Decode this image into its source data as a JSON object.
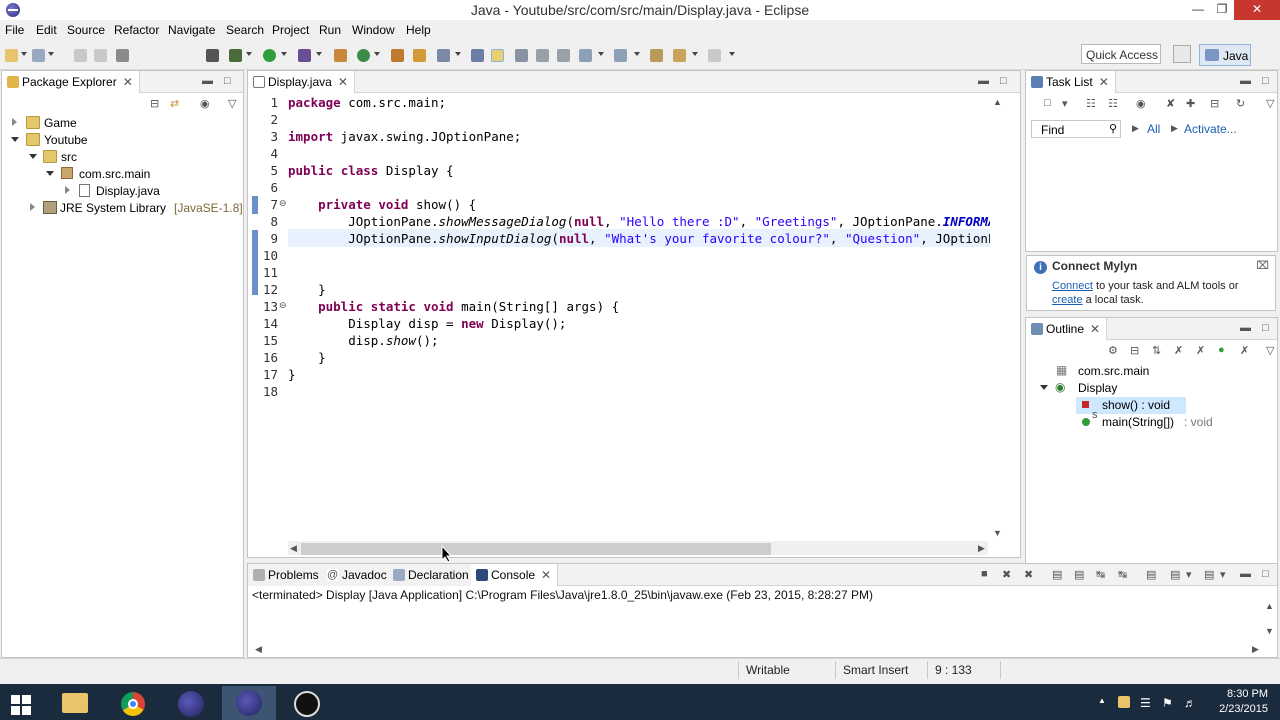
{
  "window": {
    "title": "Java - Youtube/src/com/src/main/Display.java - Eclipse"
  },
  "menu": [
    "File",
    "Edit",
    "Source",
    "Refactor",
    "Navigate",
    "Search",
    "Project",
    "Run",
    "Window",
    "Help"
  ],
  "toolbar": {
    "quick_access": "Quick Access",
    "perspective": "Java"
  },
  "package_explorer": {
    "title": "Package Explorer",
    "items": [
      {
        "label": "Game"
      },
      {
        "label": "Youtube"
      },
      {
        "label": "src"
      },
      {
        "label": "com.src.main"
      },
      {
        "label": "Display.java"
      },
      {
        "label": "JRE System Library",
        "suffix": "[JavaSE-1.8]"
      }
    ]
  },
  "editor": {
    "tab": "Display.java",
    "line_numbers": [
      "1",
      "2",
      "3",
      "4",
      "5",
      "6",
      "7",
      "8",
      "9",
      "10",
      "11",
      "12",
      "13",
      "14",
      "15",
      "16",
      "17",
      "18"
    ],
    "lines": [
      "package com.src.main;",
      "",
      "import javax.swing.JOptionPane;",
      "",
      "public class Display {",
      "",
      "    private void show() {",
      "        JOptionPane.showMessageDialog(null, \"Hello there :D\", \"Greetings\", JOptionPane.INFORMA",
      "        JOptionPane.showInputDialog(null, \"What's your favorite colour?\", \"Question\", JOptionPa",
      "",
      "",
      "    }",
      "    public static void main(String[] args) {",
      "        Display disp = new Display();",
      "        disp.show();",
      "    }",
      "}",
      ""
    ]
  },
  "task_list": {
    "title": "Task List",
    "find_placeholder": "Find",
    "all": "All",
    "activate": "Activate..."
  },
  "mylyn": {
    "title": "Connect Mylyn",
    "connect_link": "Connect",
    "text1": " to your task and ALM tools or",
    "create_link": "create",
    "text2": " a local task."
  },
  "outline": {
    "title": "Outline",
    "items": [
      {
        "label": "com.src.main"
      },
      {
        "label": "Display"
      },
      {
        "label": "show() : void"
      },
      {
        "label": "main(String[])",
        "suffix": " : void"
      }
    ]
  },
  "bottom_tabs": [
    "Problems",
    "Javadoc",
    "Declaration",
    "Console"
  ],
  "console": {
    "text": "<terminated> Display [Java Application] C:\\Program Files\\Java\\jre1.8.0_25\\bin\\javaw.exe (Feb 23, 2015, 8:28:27 PM)"
  },
  "status": {
    "writable": "Writable",
    "insert_mode": "Smart Insert",
    "position": "9 : 133"
  },
  "taskbar": {
    "time": "8:30 PM",
    "date": "2/23/2015"
  }
}
